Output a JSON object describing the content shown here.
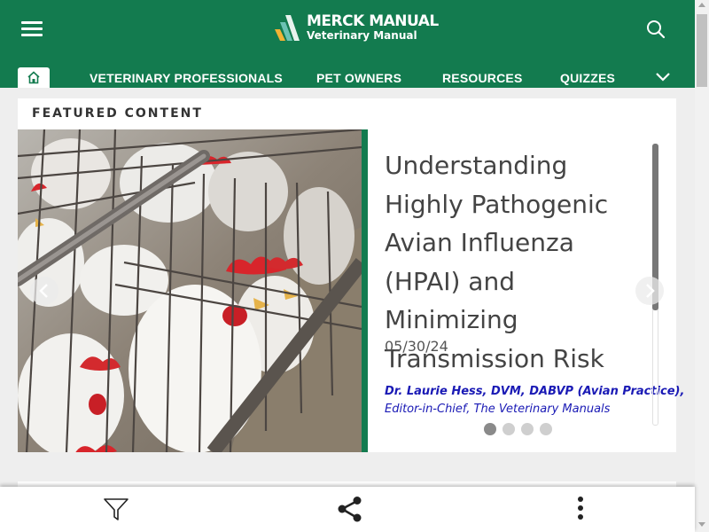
{
  "header": {
    "brand_title": "MERCK MANUAL",
    "brand_subtitle": "Veterinary Manual",
    "icons": {
      "menu": "hamburger-menu-icon",
      "search": "search-icon",
      "home": "home-icon",
      "more": "chevron-down-icon"
    }
  },
  "nav": {
    "items": [
      {
        "label": "VETERINARY PROFESSIONALS"
      },
      {
        "label": "PET OWNERS"
      },
      {
        "label": "RESOURCES"
      },
      {
        "label": "QUIZZES"
      }
    ]
  },
  "featured": {
    "section_label": "FEATURED CONTENT",
    "title": "Understanding Highly Pathogenic Avian Influenza (HPAI) and Minimizing Transmission Risk",
    "date": "05/30/24",
    "author_name": "Dr. Laurie Hess, DVM, DABVP (Avian Practice),",
    "author_role": "Editor-in-Chief, The Veterinary Manuals",
    "slide_count": 4,
    "active_slide": 1
  },
  "bottom_bar": {
    "icons": {
      "filter": "filter-icon",
      "share": "share-icon",
      "more": "more-vertical-icon"
    }
  },
  "colors": {
    "brand_green": "#137b4f",
    "link_blue": "#1a1ab5",
    "title_gray": "#444444"
  }
}
